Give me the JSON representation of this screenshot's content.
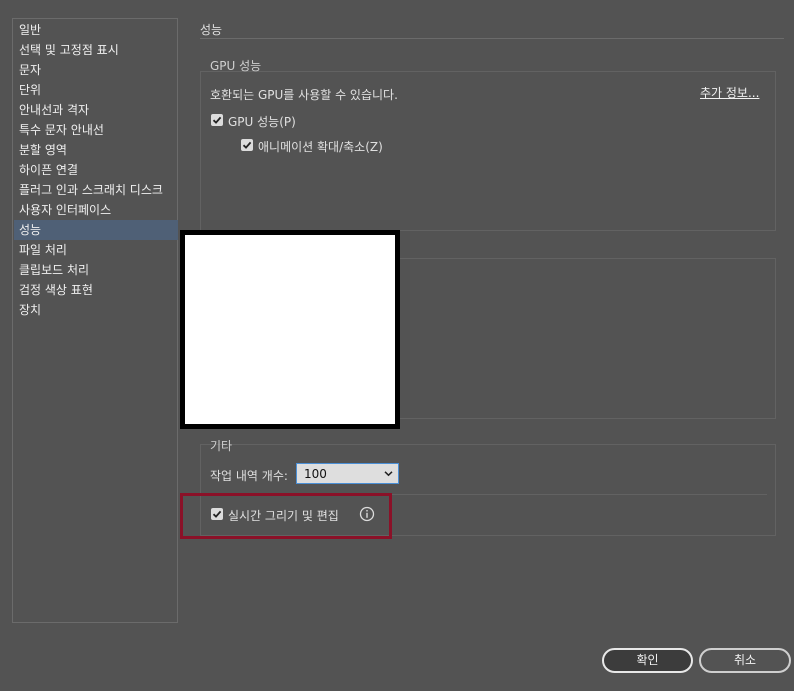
{
  "sidebar": {
    "items": [
      {
        "label": "일반"
      },
      {
        "label": "선택 및 고정점 표시"
      },
      {
        "label": "문자"
      },
      {
        "label": "단위"
      },
      {
        "label": "안내선과 격자"
      },
      {
        "label": "특수 문자 안내선"
      },
      {
        "label": "분할 영역"
      },
      {
        "label": "하이픈 연결"
      },
      {
        "label": "플러그 인과 스크래치 디스크"
      },
      {
        "label": "사용자 인터페이스"
      },
      {
        "label": "성능",
        "selected": true
      },
      {
        "label": "파일 처리"
      },
      {
        "label": "클립보드 처리"
      },
      {
        "label": "검정 색상 표현"
      },
      {
        "label": "장치"
      }
    ]
  },
  "main": {
    "section_title": "성능",
    "gpu_group": {
      "title": "GPU 성능",
      "compat_text": "호환되는 GPU를 사용할 수 있습니다.",
      "more_info_link": "추가 정보...",
      "gpu_checkbox": {
        "label": "GPU 성능(P)",
        "checked": true
      },
      "animation_checkbox": {
        "label": "애니메이션 확대/축소(Z)",
        "checked": true
      }
    },
    "misc_group": {
      "title": "기타",
      "history_label": "작업 내역 개수:",
      "history_value": "100",
      "live_checkbox": {
        "label": "실시간 그리기 및 편집",
        "checked": true
      }
    }
  },
  "footer": {
    "ok_label": "확인",
    "cancel_label": "취소"
  },
  "colors": {
    "background": "#535353",
    "selected_item": "#4f6076",
    "highlight_border": "#8b1128",
    "select_focus": "#4a8fd6"
  },
  "icons": {
    "checkbox": "check-icon",
    "dropdown": "chevron-down-icon",
    "info": "info-icon"
  }
}
